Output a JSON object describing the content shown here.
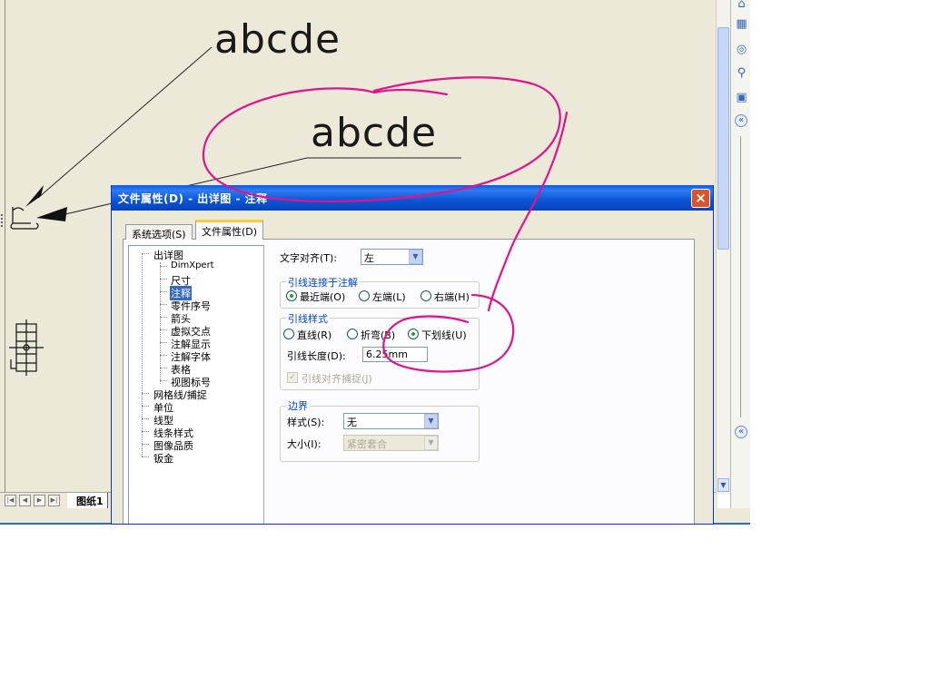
{
  "drawing": {
    "note1": "abcde",
    "note2": "abcde",
    "sheet_tab": "图纸1"
  },
  "dialog": {
    "title": "文件属性(D) - 出详图 - 注释",
    "close_glyph": "×",
    "tabs": [
      {
        "label": "系统选项(S)"
      },
      {
        "label": "文件属性(D)"
      }
    ],
    "tree": {
      "root": "出详图",
      "children": [
        "DimXpert",
        "尺寸",
        "注释",
        "零件序号",
        "箭头",
        "虚拟交点",
        "注解显示",
        "注解字体",
        "表格",
        "视图标号"
      ],
      "others": [
        "网格线/捕捉",
        "单位",
        "线型",
        "线条样式",
        "图像品质",
        "钣金"
      ],
      "selected": "注释"
    },
    "text_align": {
      "label": "文字对齐(T):",
      "value": "左"
    },
    "leader_attach": {
      "title": "引线连接于注解",
      "options": [
        {
          "label": "最近端(O)",
          "selected": true
        },
        {
          "label": "左端(L)",
          "selected": false
        },
        {
          "label": "右端(H)",
          "selected": false
        }
      ]
    },
    "leader_style": {
      "title": "引线样式",
      "options": [
        {
          "label": "直线(R)",
          "selected": false
        },
        {
          "label": "折弯(B)",
          "selected": false
        },
        {
          "label": "下划线(U)",
          "selected": true
        }
      ],
      "length_label": "引线长度(D):",
      "length_value": "6.25mm",
      "snap_label": "引线对齐捕捉(J)",
      "snap_check": "✓"
    },
    "border": {
      "title": "边界",
      "style_label": "样式(S):",
      "style_value": "无",
      "size_label": "大小(I):",
      "size_value": "紧密套合"
    }
  },
  "colors": {
    "annotation": "#e0138c",
    "titlebar": "#0a5ce4",
    "canvas": "#ece9d8"
  }
}
